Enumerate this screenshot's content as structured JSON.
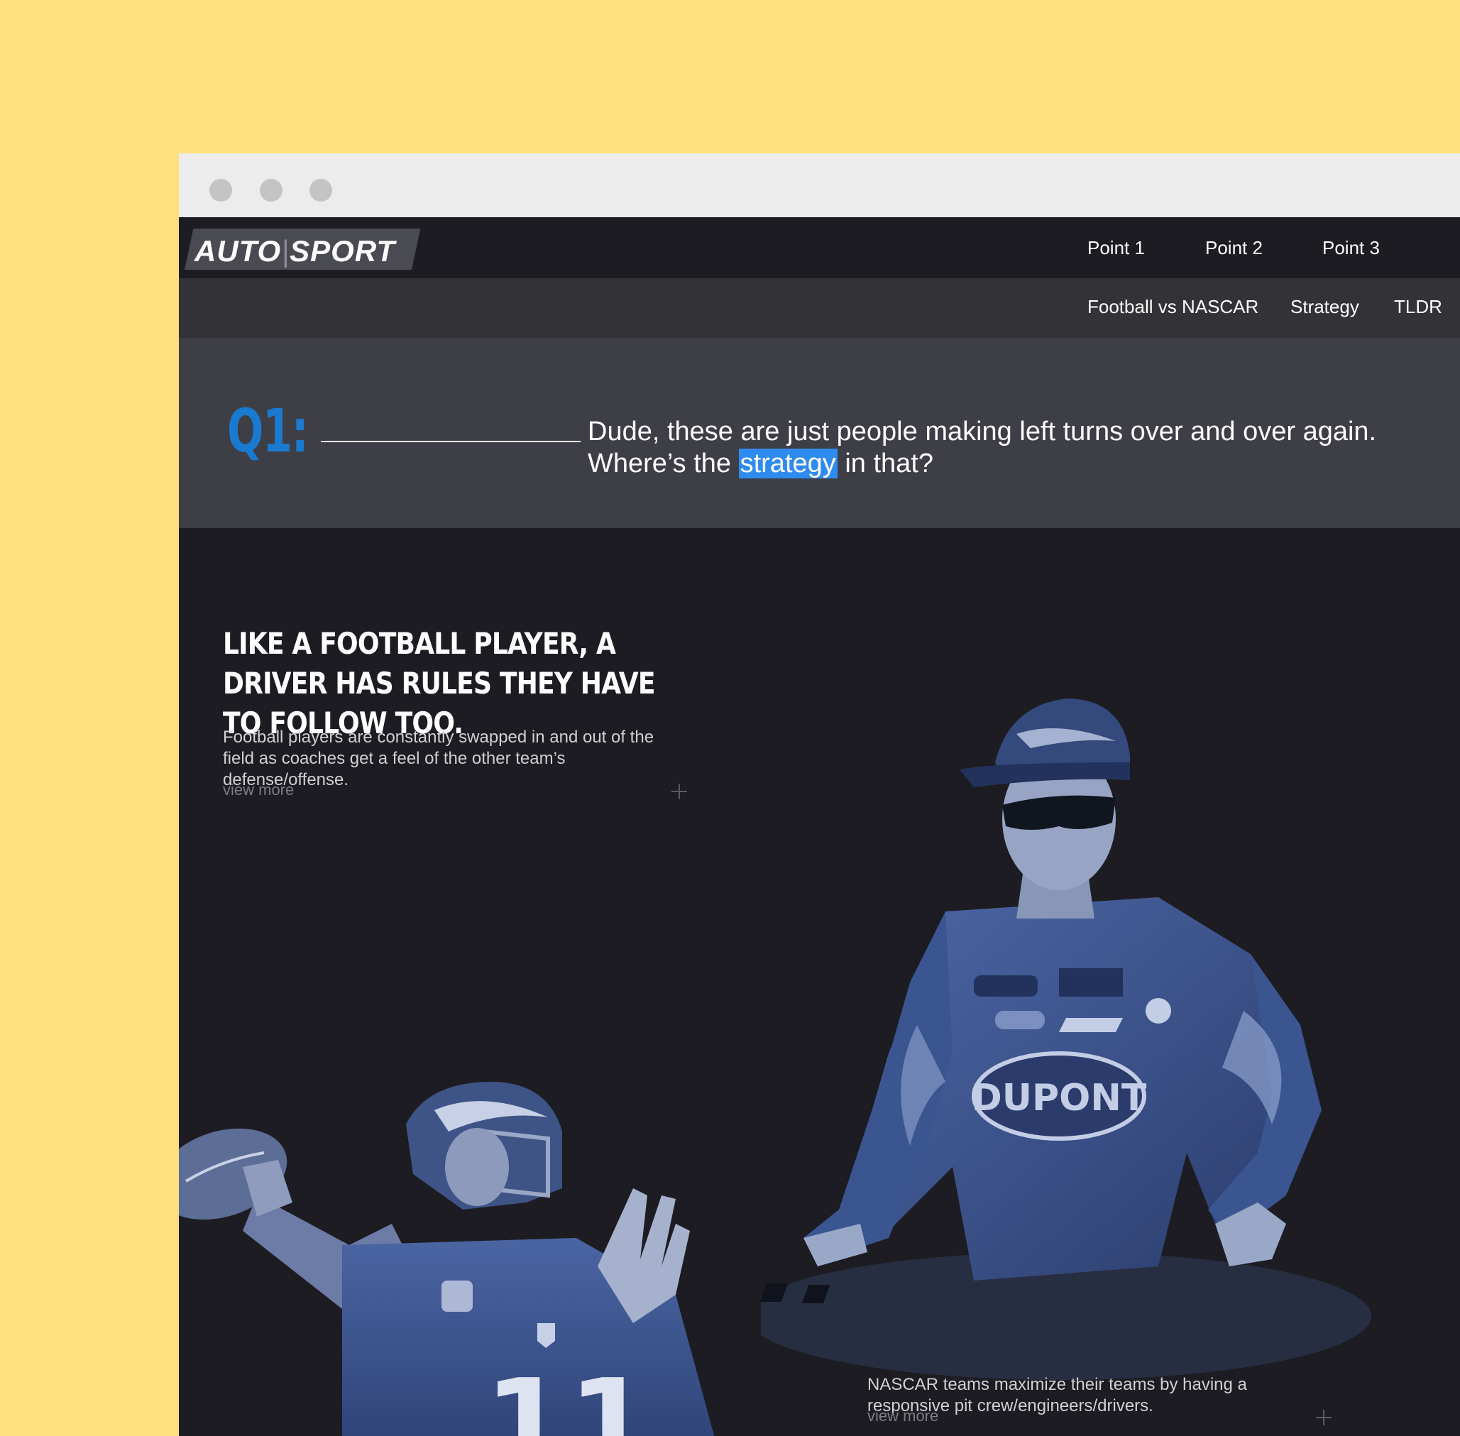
{
  "window": {
    "controls": [
      "close",
      "minimize",
      "maximize"
    ]
  },
  "header": {
    "logo_part1": "AUTO",
    "logo_separator": "|",
    "logo_part2": "SPORT",
    "nav": [
      "Point 1",
      "Point 2",
      "Point 3"
    ]
  },
  "subnav": {
    "items": [
      "Football vs NASCAR",
      "Strategy",
      "TLDR"
    ]
  },
  "question": {
    "label": "Q1:",
    "text_before": "Dude, these are just people making left turns over and over again. Where’s the ",
    "highlight": "strategy",
    "text_after": " in that?"
  },
  "section": {
    "headline": "Like a football player, a driver has rules they have to follow too.",
    "football_text": "Football players are constantly swapped in and out of the field as coaches get a feel of the other team’s defense/offense.",
    "football_view_more": "view more",
    "nascar_text": "NASCAR teams maximize their teams by having a responsive pit crew/engineers/drivers.",
    "nascar_view_more": "view more"
  },
  "images": {
    "driver": "NASCAR driver in racing suit, blue duotone",
    "football": "Football quarterback throwing, blue duotone"
  },
  "colors": {
    "page_background": "#ffe07e",
    "accent_blue": "#1a7ad0",
    "highlight_blue": "#2e8cf0",
    "dark_bg": "#1c1c22"
  }
}
